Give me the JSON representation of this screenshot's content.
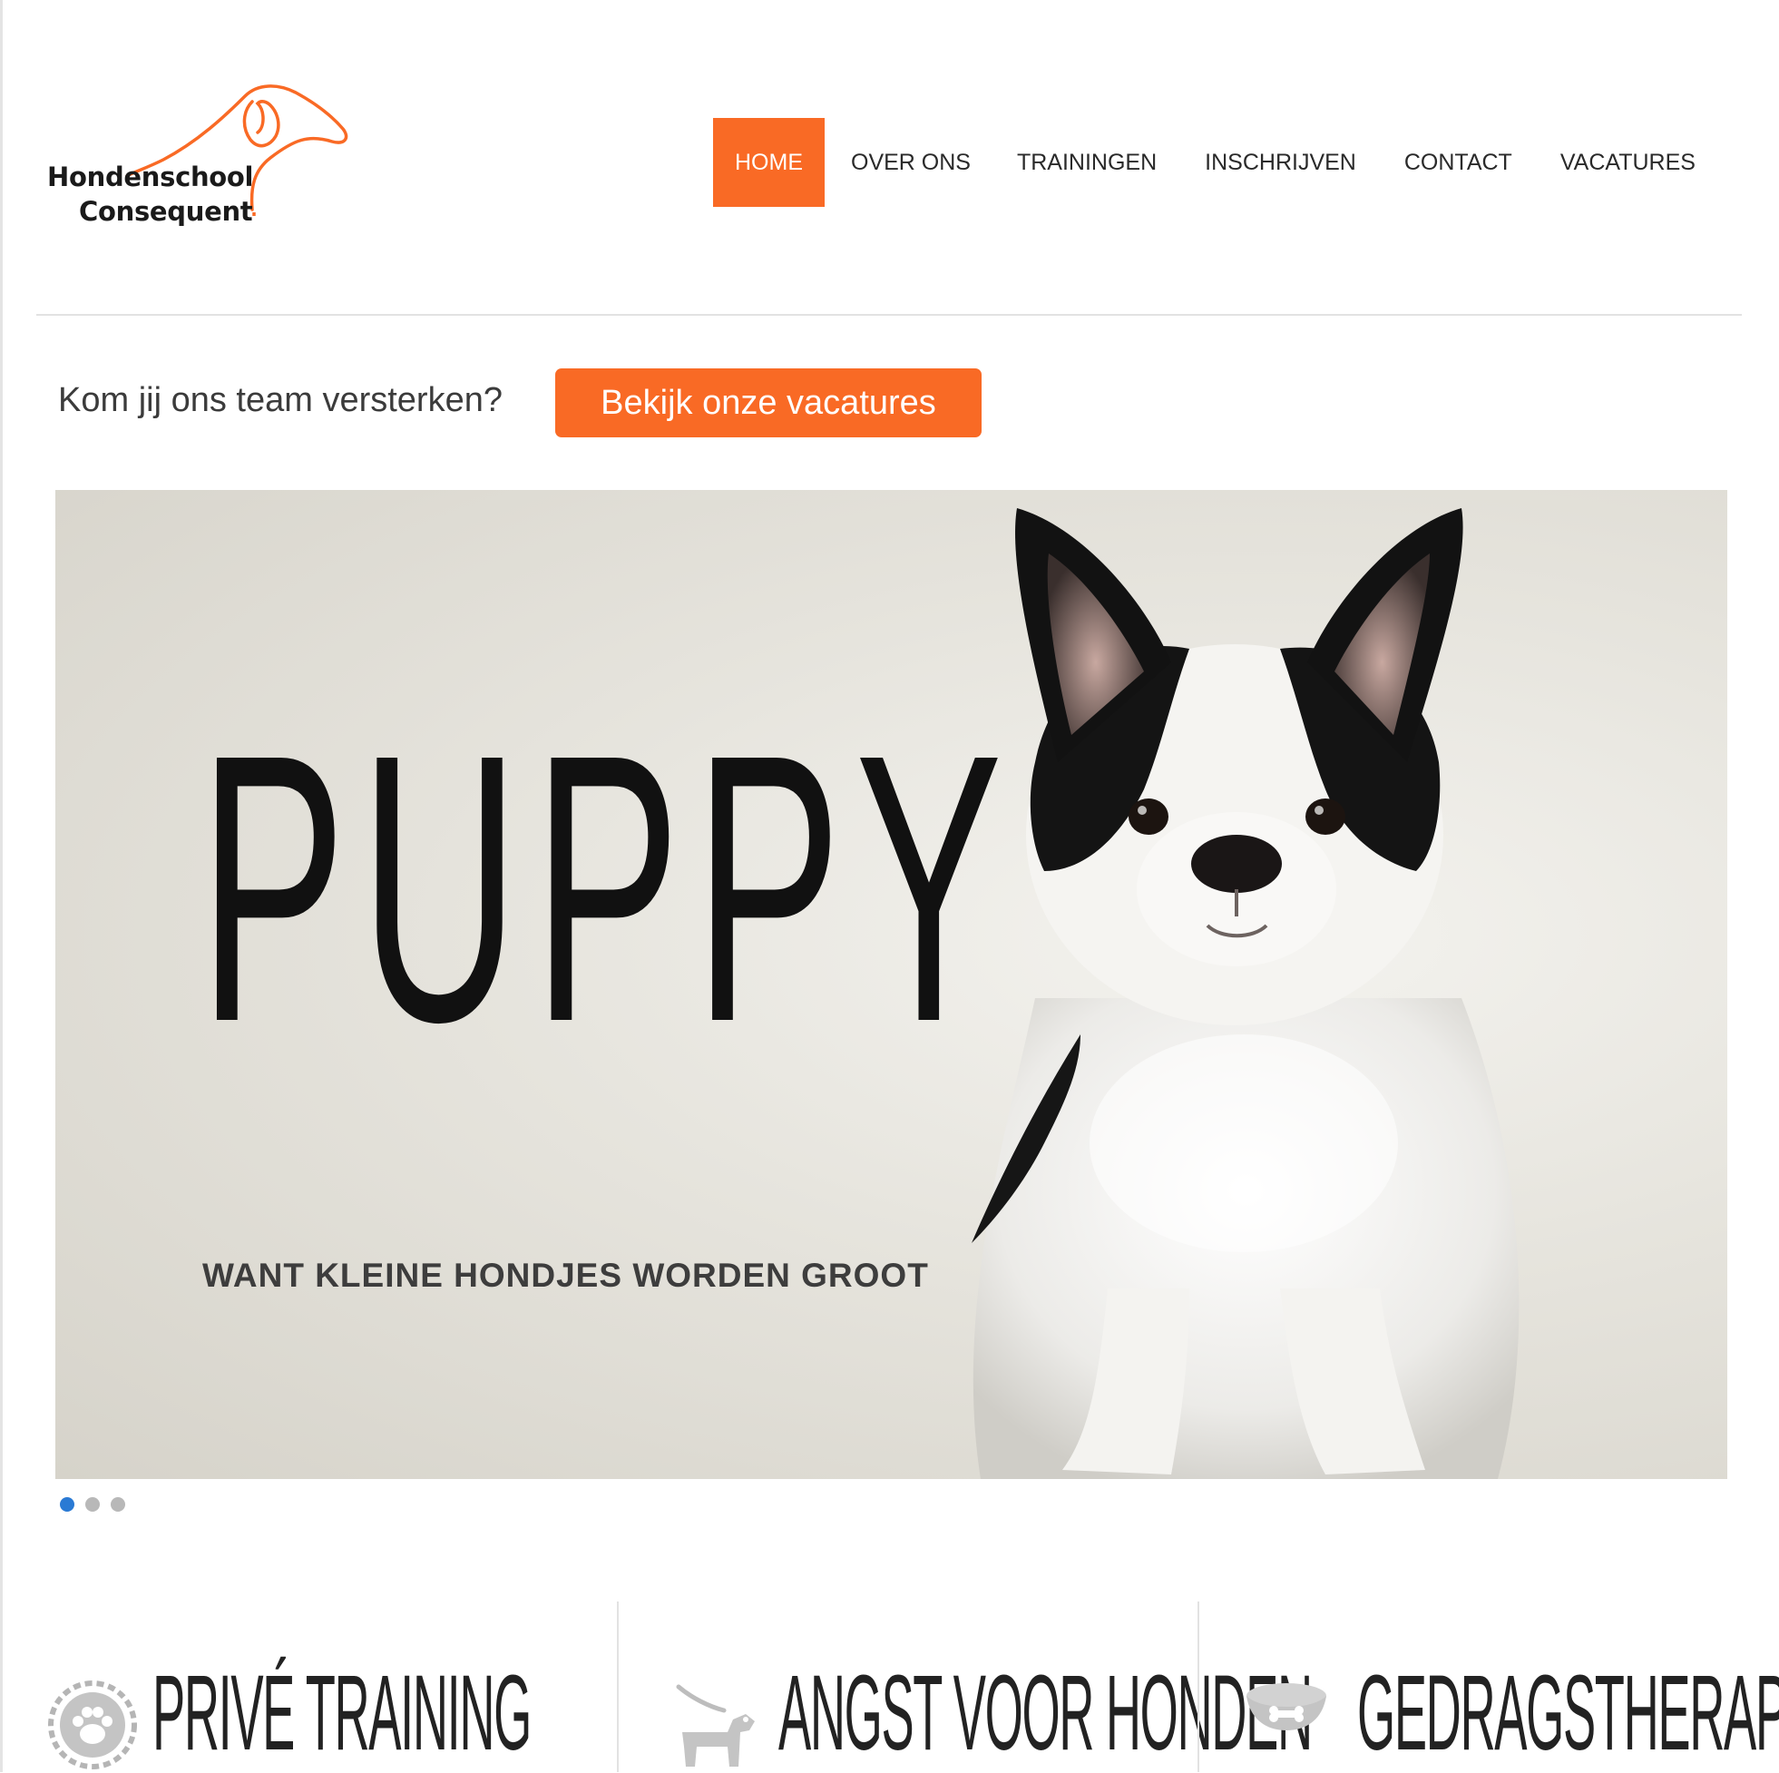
{
  "brand": {
    "line1": "Hondenschool",
    "line2": "Consequent",
    "accent_color": "#f96a25"
  },
  "nav": {
    "items": [
      {
        "label": "HOME",
        "active": true
      },
      {
        "label": "OVER ONS"
      },
      {
        "label": "TRAININGEN"
      },
      {
        "label": "INSCHRIJVEN"
      },
      {
        "label": "CONTACT"
      },
      {
        "label": "VACATURES"
      }
    ]
  },
  "recruit": {
    "text": "Kom jij ons team versterken?",
    "button_label": "Bekijk onze vacatures"
  },
  "slider": {
    "title": "PUPPY",
    "subtitle": "WANT KLEINE HONDJES WORDEN GROOT",
    "slide_count": 3,
    "active_slide": 1,
    "active_dot_color": "#2a7ad4"
  },
  "services": [
    {
      "title": "PRIVÉ TRAINING",
      "icon": "paw-badge-icon"
    },
    {
      "title": "ANGST VOOR HONDEN",
      "icon": "dog-leash-icon"
    },
    {
      "title": "GEDRAGSTHERAPIE",
      "icon": "food-bowl-icon"
    }
  ]
}
